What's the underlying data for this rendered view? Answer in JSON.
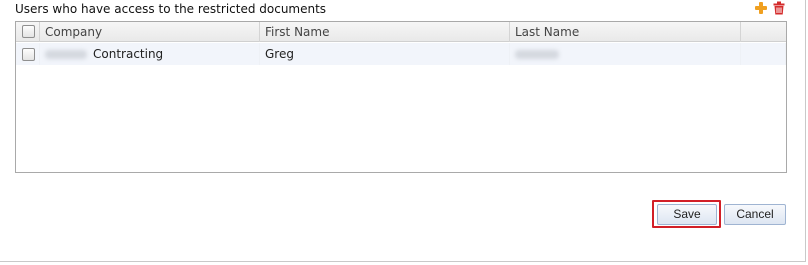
{
  "section": {
    "title": "Users who have access to the restricted documents"
  },
  "toolbar": {
    "add_icon": "plus-icon",
    "delete_icon": "trash-icon",
    "add_color": "#f0a020",
    "delete_color": "#d42b2b"
  },
  "grid": {
    "columns": [
      "Company",
      "First Name",
      "Last Name"
    ],
    "rows": [
      {
        "company_suffix": "Contracting",
        "first_name": "Greg",
        "checked": false
      }
    ]
  },
  "actions": {
    "save_label": "Save",
    "cancel_label": "Cancel",
    "highlight_color": "#d21f27"
  }
}
